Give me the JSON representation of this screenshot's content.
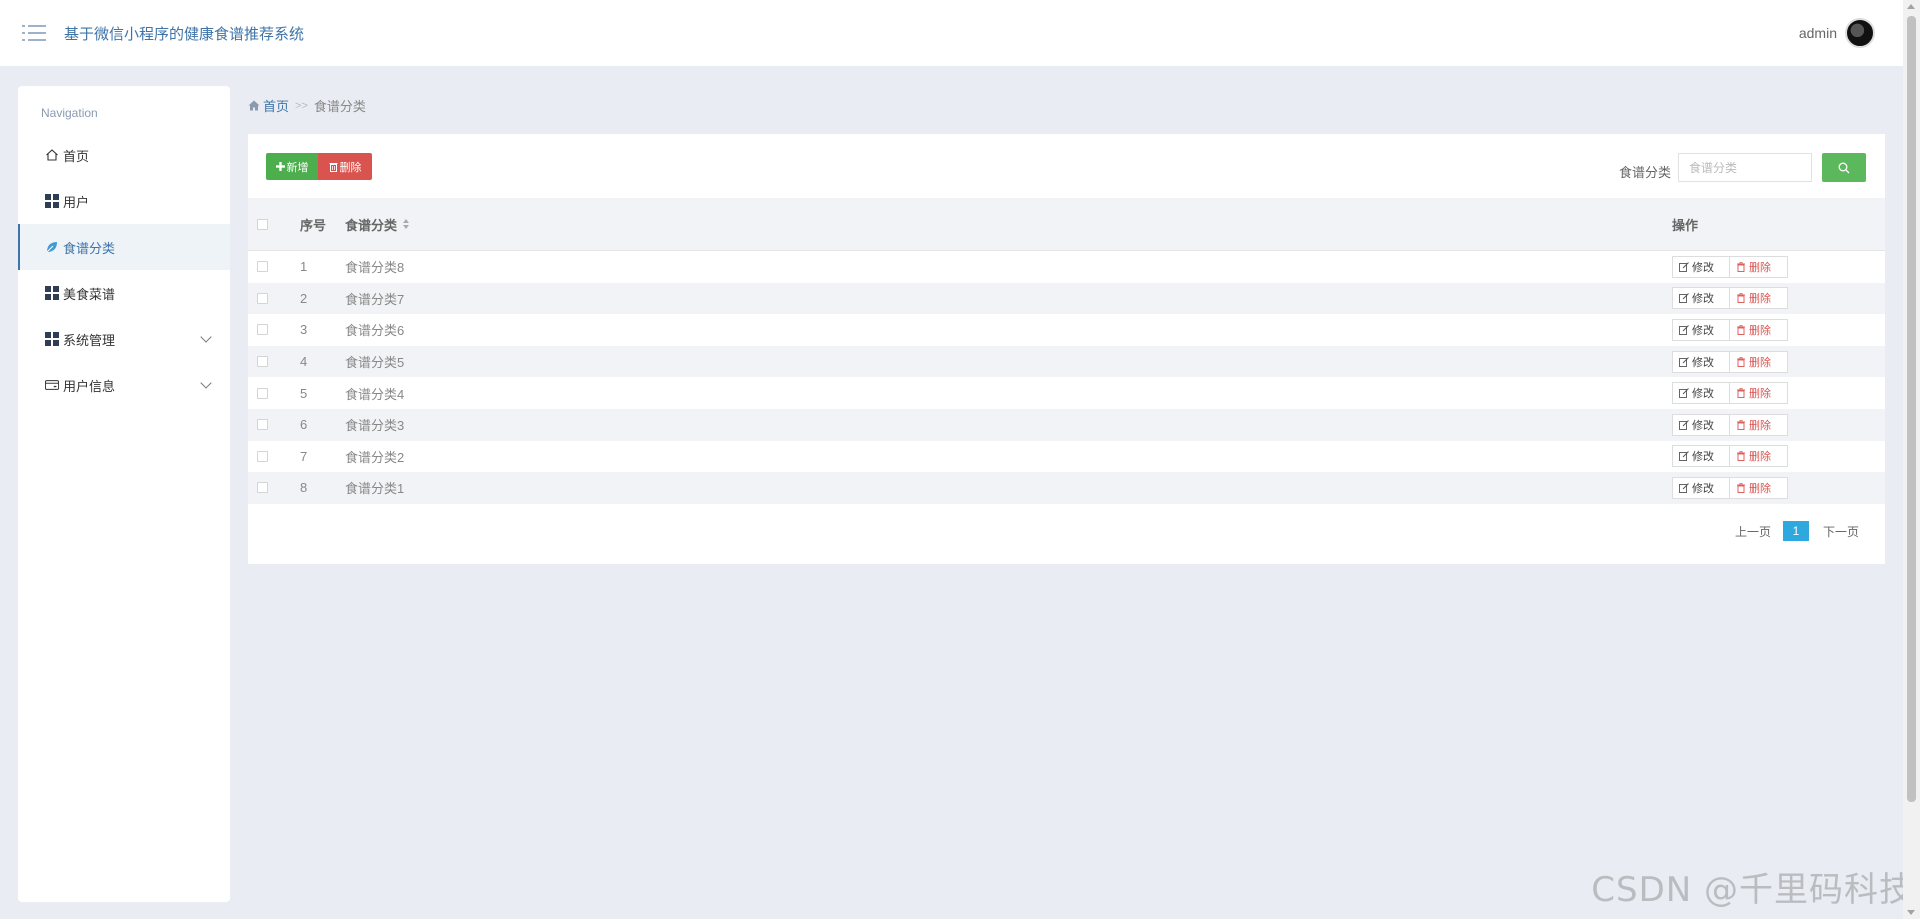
{
  "header": {
    "app_title": "基于微信小程序的健康食谱推荐系统",
    "user_name": "admin"
  },
  "sidebar": {
    "heading": "Navigation",
    "items": [
      {
        "label": "首页",
        "icon": "home-icon"
      },
      {
        "label": "用户",
        "icon": "grid-icon"
      },
      {
        "label": "食谱分类",
        "icon": "leaf-icon",
        "active": true
      },
      {
        "label": "美食菜谱",
        "icon": "grid-icon"
      },
      {
        "label": "系统管理",
        "icon": "grid-icon",
        "expandable": true
      },
      {
        "label": "用户信息",
        "icon": "card-icon",
        "expandable": true
      }
    ]
  },
  "breadcrumb": {
    "home": "首页",
    "separator": ">>",
    "current": "食谱分类"
  },
  "toolbar": {
    "add_label": "新增",
    "delete_label": "删除",
    "search_label": "食谱分类",
    "search_placeholder": "食谱分类"
  },
  "table": {
    "columns": [
      "序号",
      "食谱分类",
      "操作"
    ],
    "edit_label": "修改",
    "delete_label": "删除",
    "rows": [
      {
        "index": "1",
        "name": "食谱分类8"
      },
      {
        "index": "2",
        "name": "食谱分类7"
      },
      {
        "index": "3",
        "name": "食谱分类6"
      },
      {
        "index": "4",
        "name": "食谱分类5"
      },
      {
        "index": "5",
        "name": "食谱分类4"
      },
      {
        "index": "6",
        "name": "食谱分类3"
      },
      {
        "index": "7",
        "name": "食谱分类2"
      },
      {
        "index": "8",
        "name": "食谱分类1"
      }
    ]
  },
  "pagination": {
    "prev": "上一页",
    "current": "1",
    "next": "下一页"
  },
  "watermark": "CSDN @千里码科技",
  "colors": {
    "accent": "#3f74a8",
    "add": "#4cae4c",
    "danger": "#d9534f",
    "search": "#5cb85c",
    "page_active": "#2fa8e0"
  }
}
